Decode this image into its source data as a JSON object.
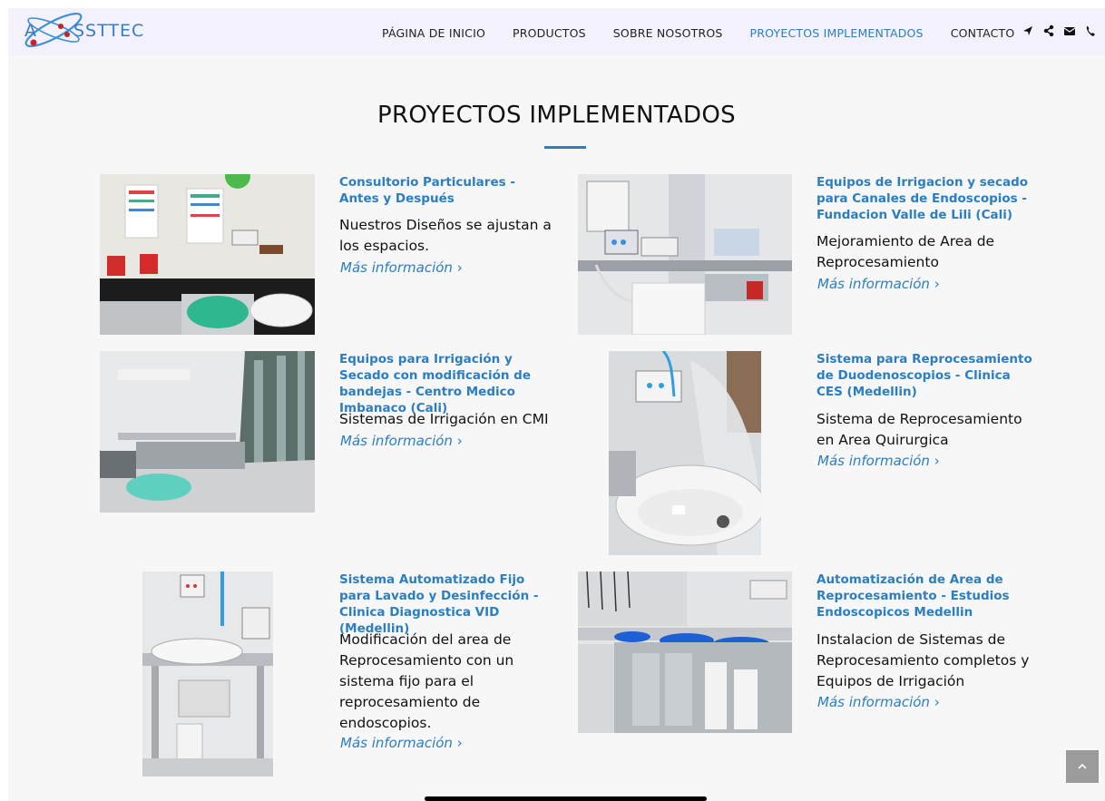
{
  "brand": {
    "logo_text": "SSTTEC",
    "logo_prefix": "A",
    "accent": "#2b7ec2"
  },
  "nav": {
    "items": [
      {
        "label": "PÁGINA DE INICIO",
        "active": false
      },
      {
        "label": "PRODUCTOS",
        "active": false
      },
      {
        "label": "SOBRE NOSOTROS",
        "active": false
      },
      {
        "label": "PROYECTOS IMPLEMENTADOS",
        "active": true
      },
      {
        "label": "CONTACTO",
        "active": false
      }
    ],
    "icons": [
      "location-arrow-icon",
      "share-icon",
      "envelope-icon",
      "phone-icon"
    ]
  },
  "page": {
    "title": "PROYECTOS IMPLEMENTADOS"
  },
  "projects": [
    {
      "title": "Consultorio Particulares - Antes y Después",
      "description": "Nuestros Diseños se ajustan a los espacios.",
      "link": "Más información"
    },
    {
      "title": "Equipos de Irrigacion y secado para Canales de Endoscopios - Fundacion Valle de Lili (Cali)",
      "description": "Mejoramiento de Area de Reprocesamiento",
      "link": "Más información"
    },
    {
      "title": "Equipos para Irrigación y Secado con modificación de bandejas - Centro Medico Imbanaco (Cali)",
      "description": "Sistemas de Irrigación en CMI",
      "link": "Más información"
    },
    {
      "title": "Sistema para Reprocesamiento de Duodenoscopios - Clinica CES (Medellin)",
      "description": "Sistema de Reprocesamiento en Area Quirurgica",
      "link": "Más información"
    },
    {
      "title": "Sistema Automatizado Fijo para Lavado y Desinfección - Clinica Diagnostica VID (Medellin)",
      "description": "Modificación del area de Reprocesamiento con un sistema fijo para el reprocesamiento de endoscopios.",
      "link": "Más información"
    },
    {
      "title": "Automatización de Area de Reprocesamiento - Estudios Endoscopicos Medellin",
      "description": "Instalacion de Sistemas de Reprocesamiento completos y Equipos de Irrigación",
      "link": "Más información"
    }
  ]
}
